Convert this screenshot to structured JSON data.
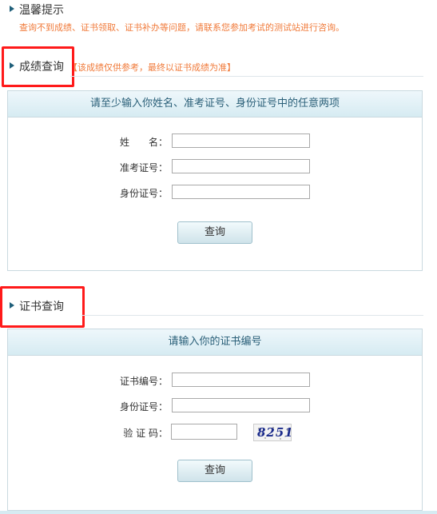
{
  "tips": {
    "title": "温馨提示",
    "text": "查询不到成绩、证书领取、证书补办等问题，请联系您参加考试的测试站进行咨询。"
  },
  "score_query": {
    "title": "成绩查询",
    "note": "【该成绩仅供参考，最终以证书成绩为准】",
    "panel_header": "请至少输入你姓名、准考证号、身份证号中的任意两项",
    "fields": [
      {
        "label": "姓　　名：",
        "value": ""
      },
      {
        "label": "准考证号：",
        "value": ""
      },
      {
        "label": "身份证号：",
        "value": ""
      }
    ],
    "button": "查询"
  },
  "cert_query": {
    "title": "证书查询",
    "panel_header": "请输入你的证书编号",
    "fields": [
      {
        "label": "证书编号：",
        "value": ""
      },
      {
        "label": "身份证号：",
        "value": ""
      },
      {
        "label": "验 证 码：",
        "value": ""
      }
    ],
    "captcha_text": "8251",
    "button": "查询"
  },
  "colors": {
    "highlight_box": "#ff1a1a",
    "tip_text": "#f07a3a",
    "panel_header_text": "#2a5f78"
  }
}
